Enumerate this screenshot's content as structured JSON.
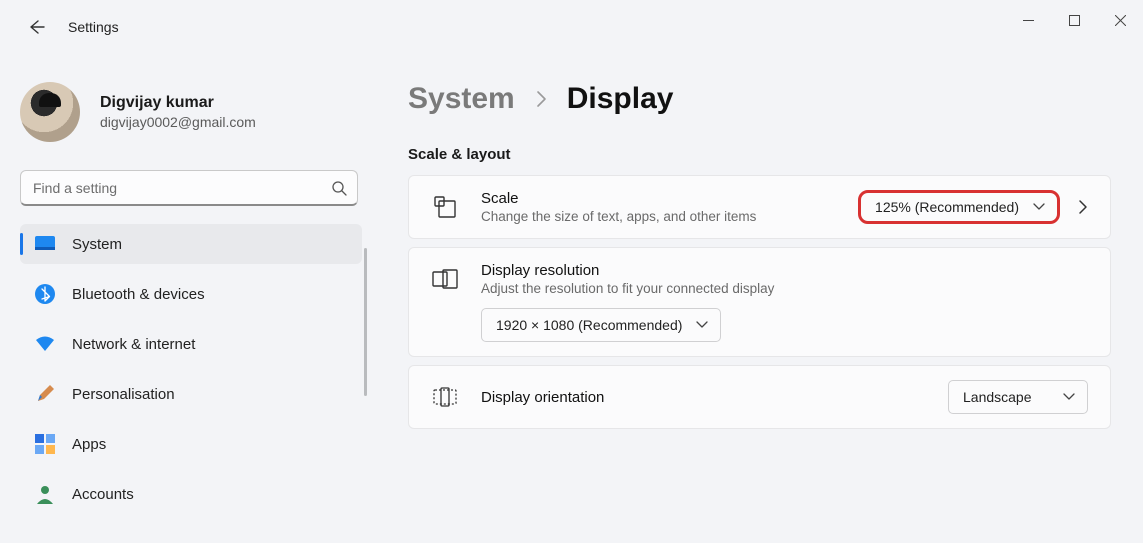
{
  "app_title": "Settings",
  "account": {
    "name": "Digvijay kumar",
    "email": "digvijay0002@gmail.com"
  },
  "search": {
    "placeholder": "Find a setting"
  },
  "sidebar": {
    "items": [
      {
        "label": "System",
        "active": true
      },
      {
        "label": "Bluetooth & devices"
      },
      {
        "label": "Network & internet"
      },
      {
        "label": "Personalisation"
      },
      {
        "label": "Apps"
      },
      {
        "label": "Accounts"
      }
    ]
  },
  "breadcrumb": {
    "parent": "System",
    "current": "Display"
  },
  "section": {
    "title": "Scale & layout"
  },
  "scale": {
    "title": "Scale",
    "subtitle": "Change the size of text, apps, and other items",
    "selected": "125% (Recommended)"
  },
  "resolution": {
    "title": "Display resolution",
    "subtitle": "Adjust the resolution to fit your connected display",
    "selected": "1920 × 1080 (Recommended)"
  },
  "orientation": {
    "title": "Display orientation",
    "selected": "Landscape"
  }
}
